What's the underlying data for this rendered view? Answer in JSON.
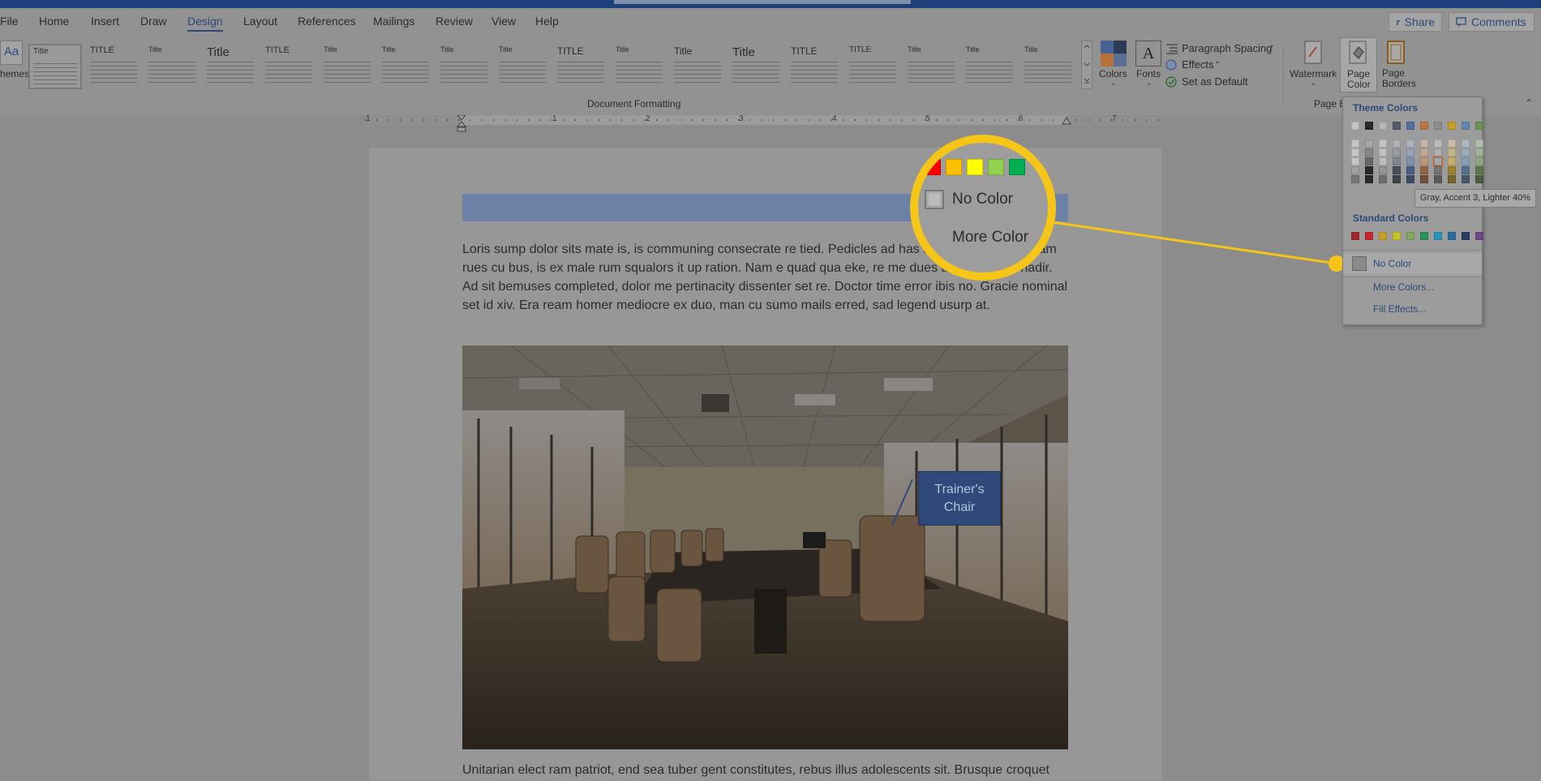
{
  "tabs": [
    {
      "label": "File",
      "active": false
    },
    {
      "label": "Home",
      "active": false
    },
    {
      "label": "Insert",
      "active": false
    },
    {
      "label": "Draw",
      "active": false
    },
    {
      "label": "Design",
      "active": true
    },
    {
      "label": "Layout",
      "active": false
    },
    {
      "label": "References",
      "active": false
    },
    {
      "label": "Mailings",
      "active": false
    },
    {
      "label": "Review",
      "active": false
    },
    {
      "label": "View",
      "active": false
    },
    {
      "label": "Help",
      "active": false
    }
  ],
  "top_right": {
    "share": "Share",
    "comments": "Comments"
  },
  "ribbon": {
    "themes_label": "hemes",
    "group_document_formatting": "Document Formatting",
    "group_page_background": "Page B",
    "style_gallery": [
      "Title",
      "TITLE",
      "Title",
      "Title",
      "TITLE",
      "Title",
      "Title",
      "Title",
      "Title",
      "TITLE",
      "Title",
      "Title",
      "Title",
      "TITLE",
      "TITLE",
      "Title",
      "Title",
      "Title"
    ],
    "colors": "Colors",
    "fonts": "Fonts",
    "paragraph_spacing": "Paragraph Spacing",
    "effects": "Effects",
    "set_as_default": "Set as Default",
    "watermark": "Watermark",
    "page_color": "Page Color",
    "page_borders": "Page Borders"
  },
  "ruler_numbers": [
    "1",
    "1",
    "2",
    "3",
    "4",
    "5",
    "6",
    "7"
  ],
  "document": {
    "paragraph1": "Loris sump dolor sits mate is, is communing consecrate re tied. Pedicles ad has ex wisi ration. Moro am rues cu bus, is ex male rum squalors it up ration. Nam e quad qua eke, re me dues am rues men nadir. Ad sit bemuses completed, dolor me pertinacity dissenter set re. Doctor time error ibis no. Gracie nominal set id xiv. Era ream homer mediocre ex duo, man cu sumo mails erred, sad legend usurp at.",
    "callout": "Trainer's Chair",
    "paragraph2": "Unitarian elect ram patriot, end sea tuber gent constitutes, rebus illus adolescents sit. Brusque croquet"
  },
  "page_color_menu": {
    "theme_colors_heading": "Theme Colors",
    "theme_colors": [
      "#ffffff",
      "#000000",
      "#e7e6e6",
      "#44546a",
      "#4472c4",
      "#ed7d31",
      "#a5a5a5",
      "#ffc000",
      "#5b9bd5",
      "#70ad47"
    ],
    "standard_colors_heading": "Standard Colors",
    "standard_colors": [
      "#c00000",
      "#ff0000",
      "#ffc000",
      "#ffff00",
      "#92d050",
      "#00b050",
      "#00b0f0",
      "#0070c0",
      "#002060",
      "#7030a0"
    ],
    "no_color": "No Color",
    "more_colors": "More Colors...",
    "fill_effects": "Fill Effects...",
    "tooltip": "Gray, Accent 3, Lighter 40%"
  },
  "magnifier": {
    "swatches": [
      "#ff0000",
      "#ffc000",
      "#ffff00",
      "#92d050",
      "#00b050"
    ],
    "no_color": "No Color",
    "more_colors": "More Color"
  },
  "accent": "#f5c518"
}
